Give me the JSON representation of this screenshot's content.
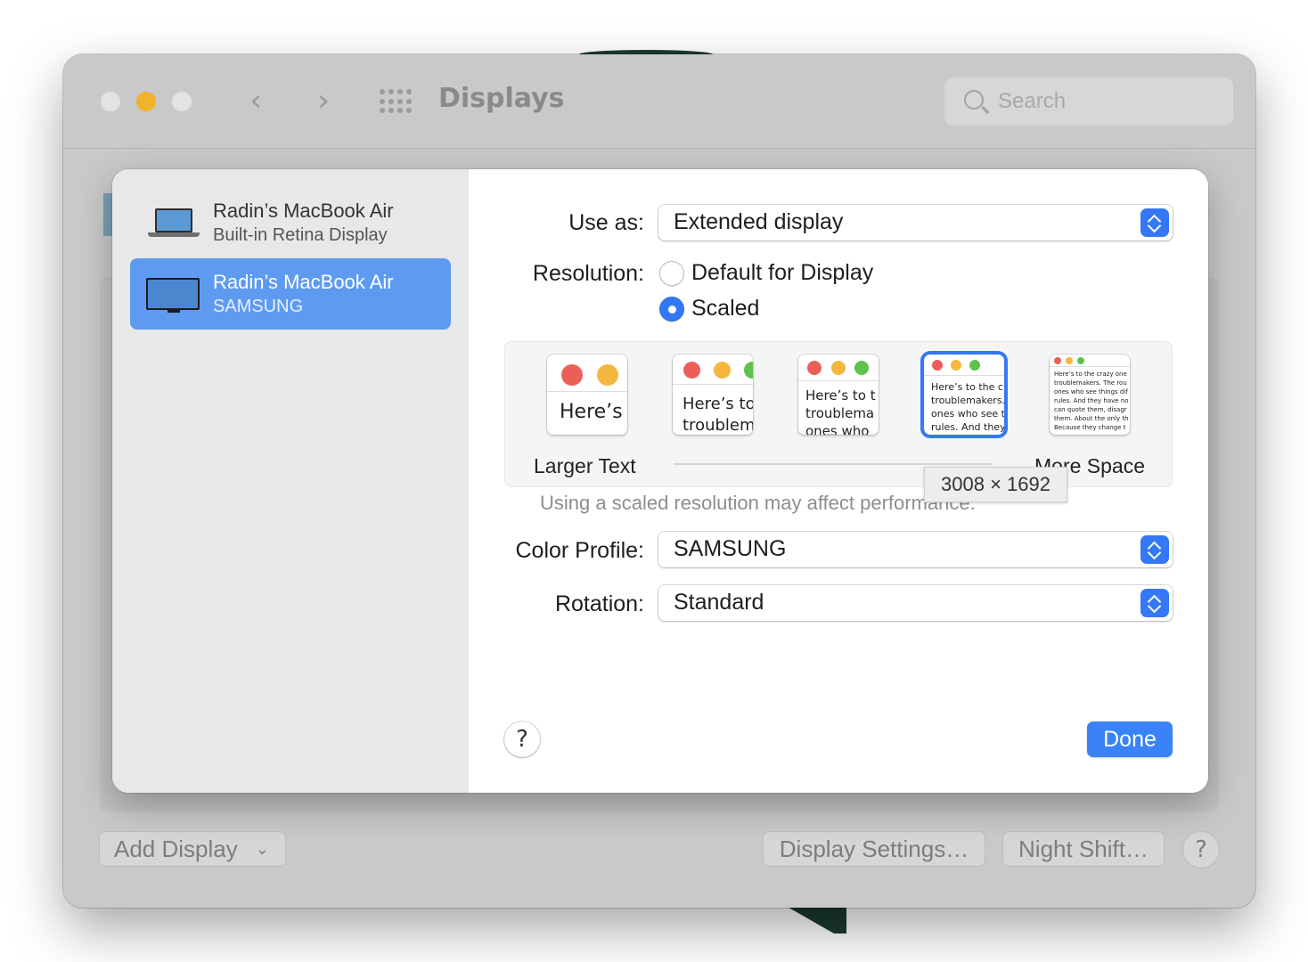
{
  "window": {
    "title": "Displays"
  },
  "search": {
    "placeholder": "Search"
  },
  "colors": {
    "accent": "#3478f6",
    "selection": "#5e9bf0",
    "close": "#e3e3e3",
    "minimize": "#f2b22c"
  },
  "displays": [
    {
      "name": "Radin’s MacBook Air",
      "subtitle": "Built-in Retina Display",
      "icon": "laptop-icon"
    },
    {
      "name": "Radin’s MacBook Air",
      "subtitle": "SAMSUNG",
      "icon": "monitor-icon"
    }
  ],
  "settings": {
    "use_as": {
      "label": "Use as:",
      "value": "Extended display"
    },
    "resolution": {
      "label": "Resolution:",
      "options": [
        {
          "label": "Default for Display",
          "selected": false
        },
        {
          "label": "Scaled",
          "selected": true
        }
      ]
    },
    "scaled": {
      "larger_label": "Larger Text",
      "more_label": "More Space",
      "tooltip": "3008 × 1692",
      "selected_index": 3,
      "thumbs": [
        {
          "lines": [
            "Here’s"
          ]
        },
        {
          "lines": [
            "Here’s to",
            "troublem"
          ]
        },
        {
          "lines": [
            "Here’s to t",
            "troublema",
            "ones who"
          ]
        },
        {
          "lines": [
            "Here’s to the cr",
            "troublemakers.",
            "ones who see t",
            "rules. And they"
          ]
        },
        {
          "lines": [
            "Here’s to the crazy one",
            "troublemakers. The rou",
            "ones who see things dif",
            "rules. And they have no",
            "can quote them, disagr",
            "them. About the only th",
            "Because they change t"
          ]
        }
      ]
    },
    "note": "Using a scaled resolution may affect performance.",
    "color_profile": {
      "label": "Color Profile:",
      "value": "SAMSUNG"
    },
    "rotation": {
      "label": "Rotation:",
      "value": "Standard"
    }
  },
  "buttons": {
    "help": "?",
    "done": "Done",
    "add_display": "Add Display",
    "display_settings": "Display Settings…",
    "night_shift": "Night Shift…",
    "window_help": "?"
  }
}
